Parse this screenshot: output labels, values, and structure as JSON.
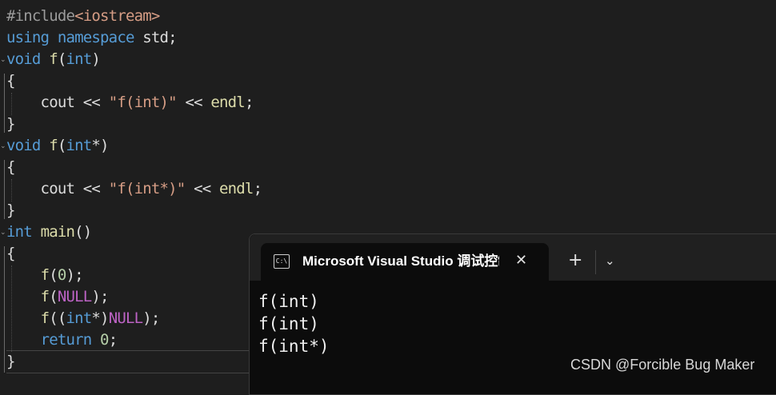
{
  "editor": {
    "lines": [
      [
        {
          "t": "#include",
          "c": "pre"
        },
        {
          "t": "<iostream>",
          "c": "str"
        }
      ],
      [
        {
          "t": "using",
          "c": "kw"
        },
        {
          "t": " ",
          "c": "tok"
        },
        {
          "t": "namespace",
          "c": "kw"
        },
        {
          "t": " std;",
          "c": "tok"
        }
      ],
      [
        {
          "t": "void",
          "c": "kw"
        },
        {
          "t": " ",
          "c": "tok"
        },
        {
          "t": "f",
          "c": "fn"
        },
        {
          "t": "(",
          "c": "pun"
        },
        {
          "t": "int",
          "c": "kw"
        },
        {
          "t": ")",
          "c": "pun"
        }
      ],
      [
        {
          "t": "{",
          "c": "pun"
        }
      ],
      [
        {
          "t": "    cout ",
          "c": "tok"
        },
        {
          "t": "<<",
          "c": "tok"
        },
        {
          "t": " ",
          "c": "tok"
        },
        {
          "t": "\"f(int)\"",
          "c": "str"
        },
        {
          "t": " << ",
          "c": "tok"
        },
        {
          "t": "endl",
          "c": "fn"
        },
        {
          "t": ";",
          "c": "pun"
        }
      ],
      [
        {
          "t": "}",
          "c": "pun"
        }
      ],
      [
        {
          "t": "void",
          "c": "kw"
        },
        {
          "t": " ",
          "c": "tok"
        },
        {
          "t": "f",
          "c": "fn"
        },
        {
          "t": "(",
          "c": "pun"
        },
        {
          "t": "int",
          "c": "kw"
        },
        {
          "t": "*)",
          "c": "pun"
        }
      ],
      [
        {
          "t": "{",
          "c": "pun"
        }
      ],
      [
        {
          "t": "    cout ",
          "c": "tok"
        },
        {
          "t": "<<",
          "c": "tok"
        },
        {
          "t": " ",
          "c": "tok"
        },
        {
          "t": "\"f(int*)\"",
          "c": "str"
        },
        {
          "t": " << ",
          "c": "tok"
        },
        {
          "t": "endl",
          "c": "fn"
        },
        {
          "t": ";",
          "c": "pun"
        }
      ],
      [
        {
          "t": "}",
          "c": "pun"
        }
      ],
      [
        {
          "t": "int",
          "c": "kw"
        },
        {
          "t": " ",
          "c": "tok"
        },
        {
          "t": "main",
          "c": "fn"
        },
        {
          "t": "()",
          "c": "pun"
        }
      ],
      [
        {
          "t": "{",
          "c": "pun"
        }
      ],
      [
        {
          "t": "    ",
          "c": "tok"
        },
        {
          "t": "f",
          "c": "fn"
        },
        {
          "t": "(",
          "c": "pun"
        },
        {
          "t": "0",
          "c": "num"
        },
        {
          "t": ");",
          "c": "pun"
        }
      ],
      [
        {
          "t": "    ",
          "c": "tok"
        },
        {
          "t": "f",
          "c": "fn"
        },
        {
          "t": "(",
          "c": "pun"
        },
        {
          "t": "NULL",
          "c": "mac"
        },
        {
          "t": ");",
          "c": "pun"
        }
      ],
      [
        {
          "t": "    ",
          "c": "tok"
        },
        {
          "t": "f",
          "c": "fn"
        },
        {
          "t": "((",
          "c": "pun"
        },
        {
          "t": "int",
          "c": "kw"
        },
        {
          "t": "*)",
          "c": "pun"
        },
        {
          "t": "NULL",
          "c": "mac"
        },
        {
          "t": ");",
          "c": "pun"
        }
      ],
      [
        {
          "t": "    ",
          "c": "tok"
        },
        {
          "t": "return",
          "c": "kw"
        },
        {
          "t": " ",
          "c": "tok"
        },
        {
          "t": "0",
          "c": "num"
        },
        {
          "t": ";",
          "c": "pun"
        }
      ],
      [
        {
          "t": "}",
          "c": "pun"
        }
      ]
    ]
  },
  "terminal": {
    "tab_title": "Microsoft Visual Studio 调试控制台",
    "icon_text": "C:\\",
    "close_glyph": "✕",
    "new_tab_glyph": "+",
    "dropdown_glyph": "⌄",
    "output": [
      "f(int)",
      "f(int)",
      "f(int*)"
    ]
  },
  "watermark": "CSDN @Forcible Bug Maker",
  "colors": {
    "editor_bg": "#1e1e1e",
    "keyword": "#569cd6",
    "function": "#dcdcaa",
    "string": "#d69d85",
    "number": "#b5cea8",
    "macro": "#bd63c5",
    "terminal_bg": "#0c0c0c"
  }
}
